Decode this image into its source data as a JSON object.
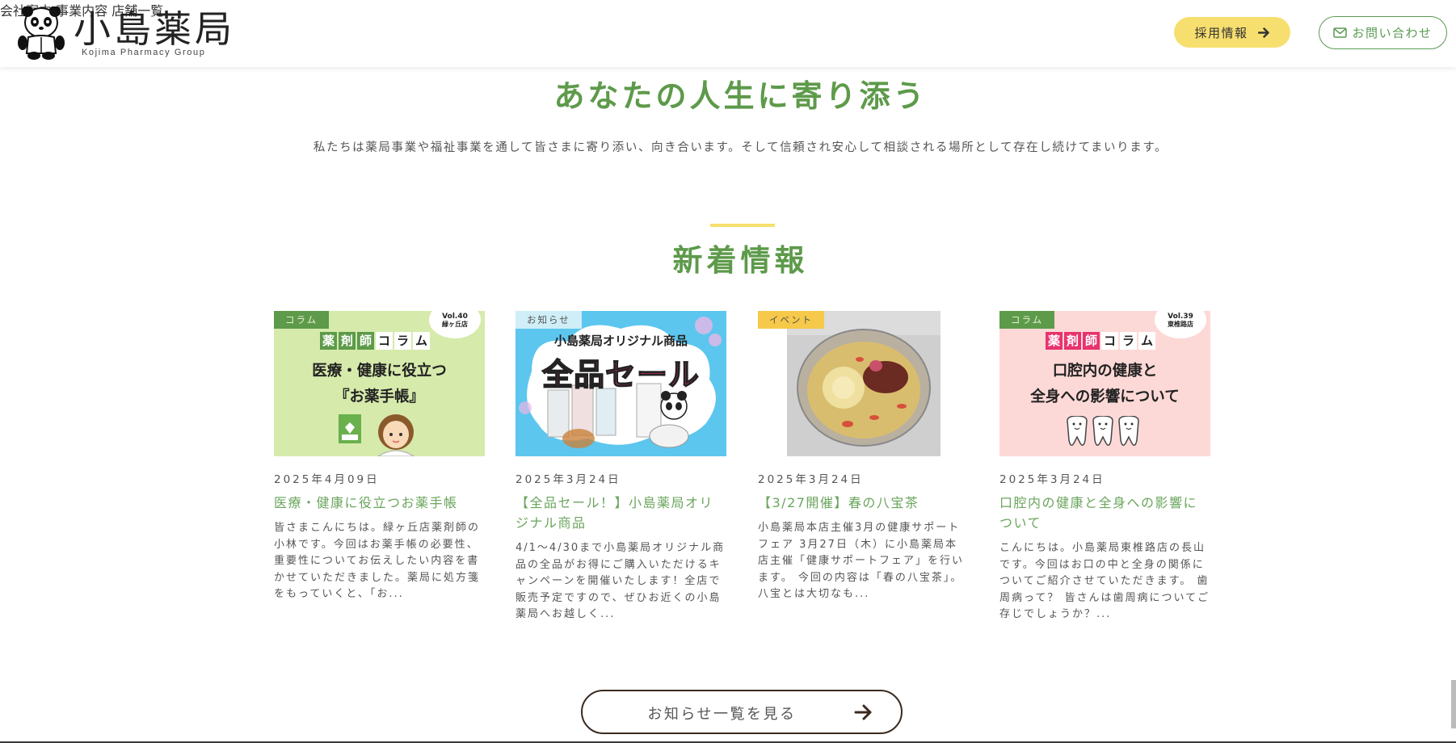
{
  "header": {
    "logo_title": "小島薬局",
    "logo_sub": "Kojima Pharmacy Group",
    "nav": [
      "会社案内",
      "事業内容",
      "店舗一覧"
    ],
    "recruit_label": "採用情報",
    "contact_label": "お問い合わせ"
  },
  "hero": {
    "title": "あなたの人生に寄り添う",
    "text": "私たちは薬局事業や福祉事業を通して皆さまに寄り添い、向き合います。そして信頼され安心して相談される場所として存在し続けてまいります。"
  },
  "news": {
    "title": "新着情報",
    "cards": [
      {
        "tag": "コラム",
        "date": "2025年4月09日",
        "title": "医療・健康に役立つお薬手帳",
        "excerpt": "皆さまこんにちは。緑ヶ丘店薬剤師の小林です。今回はお薬手帳の必要性、重要性についてお伝えしたい内容を書かせていただきました。薬局に処方箋をもっていくと、「お...",
        "thumb": {
          "vol": "Vol.40",
          "store": "緑ヶ丘店",
          "column_chars": [
            "薬",
            "剤",
            "師",
            "コ",
            "ラ",
            "ム"
          ],
          "line1": "医療・健康に役立つ",
          "line2": "『お薬手帳』"
        }
      },
      {
        "tag": "お知らせ",
        "date": "2025年3月24日",
        "title": "【全品セール！】小島薬局オリジナル商品",
        "excerpt": "4/1～4/30まで小島薬局オリジナル商品の全品がお得にご購入いただけるキャンペーンを開催いたします！全店で販売予定ですので、ぜひお近くの小島薬局へお越しく...",
        "thumb": {
          "headline": "小島薬局オリジナル商品",
          "sale": "全品セール"
        }
      },
      {
        "tag": "イベント",
        "date": "2025年3月24日",
        "title": "【3/27開催】春の八宝茶",
        "excerpt": "小島薬局本店主催3月の健康サポートフェア 3月27日（木）に小島薬局本店主催「健康サポートフェア」を行います。 今回の内容は「春の八宝茶」。八宝とは大切なも...",
        "thumb": {}
      },
      {
        "tag": "コラム",
        "date": "2025年3月24日",
        "title": "口腔内の健康と全身への影響について",
        "excerpt": "こんにちは。小島薬局東椎路店の長山です。今回はお口の中と全身の関係についてご紹介させていただきます。 歯周病って？ 皆さんは歯周病についてご存じでしょうか？...",
        "thumb": {
          "vol": "Vol.39",
          "store": "東椎路店",
          "column_chars": [
            "薬",
            "剤",
            "師",
            "コ",
            "ラ",
            "ム"
          ],
          "line1": "口腔内の健康と",
          "line2": "全身への影響について"
        }
      }
    ],
    "more_label": "お知らせ一覧を見る"
  },
  "colors": {
    "brand_green": "#5d9a4a",
    "yellow": "#f6df6e"
  }
}
